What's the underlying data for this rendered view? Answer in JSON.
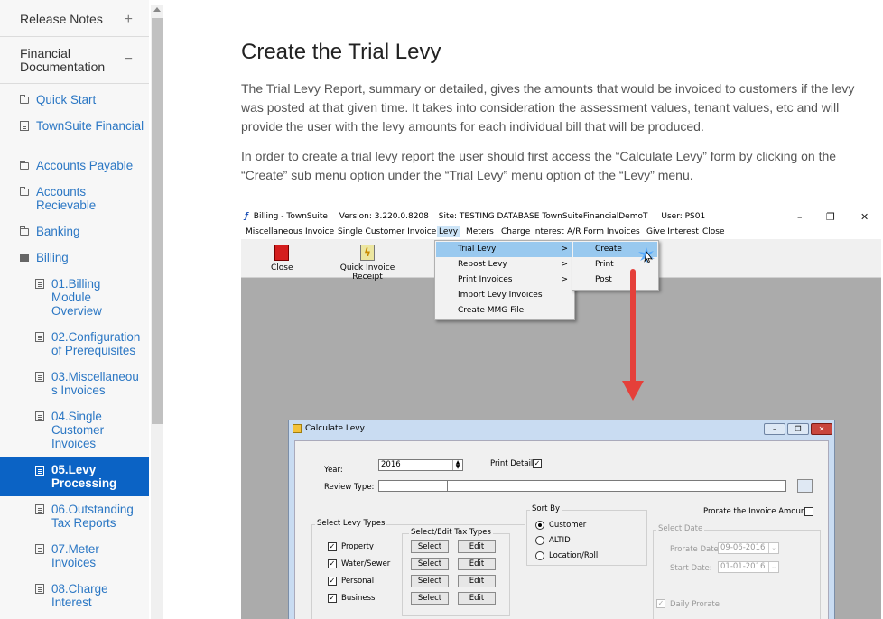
{
  "sidebar": {
    "release_notes": "Release Notes",
    "release_toggle": "+",
    "financial_documentation": "Financial Documentation",
    "financial_toggle": "−",
    "items": [
      {
        "label": "Quick Start",
        "icon": "folder-icon"
      },
      {
        "label": "TownSuite Financial",
        "icon": "document-icon"
      },
      {
        "label": "Accounts Payable",
        "icon": "folder-icon"
      },
      {
        "label": "Accounts Recievable",
        "icon": "folder-icon"
      },
      {
        "label": "Banking",
        "icon": "folder-icon"
      },
      {
        "label": "Billing",
        "icon": "folder-open-icon"
      }
    ],
    "billing_items": [
      {
        "label": "01.Billing Module Overview"
      },
      {
        "label": "02.Configuration of Prerequisites"
      },
      {
        "label": "03.Miscellaneous Invoices"
      },
      {
        "label": "04.Single Customer Invoices"
      },
      {
        "label": "05.Levy Processing",
        "active": true
      },
      {
        "label": "06.Outstanding Tax Reports"
      },
      {
        "label": "07.Meter Invoices"
      },
      {
        "label": "08.Charge Interest"
      }
    ]
  },
  "article": {
    "title": "Create the Trial Levy",
    "paragraph1": "The Trial Levy Report, summary or detailed, gives the amounts that would be invoiced to customers if the levy was posted at that given time. It takes into consideration the assessment values, tenant values, etc and will provide the user with the levy amounts for each individual bill that will be produced.",
    "paragraph2": "In order to create a trial levy report the user should first access the “Calculate Levy” form by clicking on the “Create” sub menu option under the “Trial Levy” menu option of the “Levy” menu."
  },
  "screenshot": {
    "title_app": "Billing - TownSuite",
    "title_version": "Version: 3.220.0.8208",
    "title_site": "Site: TESTING DATABASE TownSuiteFinancialDemoT",
    "title_user": "User: PS01",
    "window_controls": {
      "minimize": "–",
      "restore": "❐",
      "close": "✕"
    },
    "menu": [
      "Miscellaneous Invoice",
      "Single Customer Invoice",
      "Levy",
      "Meters",
      "Charge Interest",
      "A/R Form Invoices",
      "Give Interest",
      "Close"
    ],
    "toolbar": {
      "close": "Close",
      "quick_invoice_receipt": "Quick Invoice Receipt"
    },
    "levy_menu": [
      "Trial Levy",
      "Repost Levy",
      "Print Invoices",
      "Import Levy Invoices",
      "Create MMG File"
    ],
    "trial_levy_menu": [
      "Create",
      "Print",
      "Post"
    ],
    "submenu_arrow": ">",
    "dialog": {
      "title": "Calculate Levy",
      "year_label": "Year:",
      "year_value": "2016",
      "print_detail_label": "Print Detail",
      "review_type_label": "Review Type:",
      "prorate_label": "Prorate the Invoice Amounts",
      "select_levy_types": "Select Levy Types",
      "select_edit_tax_types": "Select/Edit Tax Types",
      "levy_types": [
        "Property",
        "Water/Sewer",
        "Personal",
        "Business"
      ],
      "select_btn": "Select",
      "edit_btn": "Edit",
      "sort_by": "Sort By",
      "sort_options": [
        "Customer",
        "ALTID",
        "Location/Roll"
      ],
      "select_date": "Select Date",
      "prorate_date_label": "Prorate Date:",
      "prorate_date_value": "09-06-2016",
      "start_date_label": "Start Date:",
      "start_date_value": "01-01-2016",
      "daily_prorate": "Daily Prorate"
    }
  },
  "colors": {
    "link": "#2b77c4",
    "active_bg": "#0b63c5",
    "arrow": "#e5403a"
  }
}
